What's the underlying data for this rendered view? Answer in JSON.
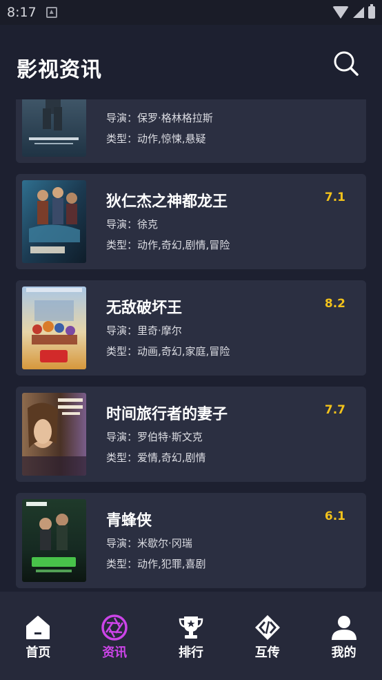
{
  "status_bar": {
    "time": "8:17"
  },
  "header": {
    "title": "影视资讯"
  },
  "labels": {
    "director": "导演：",
    "genre": "类型："
  },
  "movies": [
    {
      "title": "",
      "score": "",
      "director": "保罗·格林格拉斯",
      "genre": "动作,惊悚,悬疑",
      "poster_text": "THE BOURNE ULTIMATUM"
    },
    {
      "title": "狄仁杰之神都龙王",
      "score": "7.1",
      "director": "徐克",
      "genre": "动作,奇幻,剧情,冒险",
      "poster_text": "狄仁杰"
    },
    {
      "title": "无敌破坏王",
      "score": "8.2",
      "director": "里奇·摩尔",
      "genre": "动画,奇幻,家庭,冒险",
      "poster_text": "无敌破坏王"
    },
    {
      "title": "时间旅行者的妻子",
      "score": "7.7",
      "director": "罗伯特·斯文克",
      "genre": "爱情,奇幻,剧情",
      "poster_text": "The Time Traveler's Wife"
    },
    {
      "title": "青蜂侠",
      "score": "6.1",
      "director": "米歇尔·冈瑞",
      "genre": "动作,犯罪,喜剧",
      "poster_text": "青蜂侠"
    }
  ],
  "tabs": [
    {
      "label": "首页",
      "icon": "home-icon",
      "active": false
    },
    {
      "label": "资讯",
      "icon": "aperture-icon",
      "active": true
    },
    {
      "label": "排行",
      "icon": "trophy-icon",
      "active": false
    },
    {
      "label": "互传",
      "icon": "transfer-icon",
      "active": false
    },
    {
      "label": "我的",
      "icon": "user-icon",
      "active": false
    }
  ],
  "colors": {
    "background": "#1d2030",
    "card": "#2b2f41",
    "score": "#f2c21b",
    "active_tab": "#cc44e8",
    "tab_bar": "#26293a"
  }
}
